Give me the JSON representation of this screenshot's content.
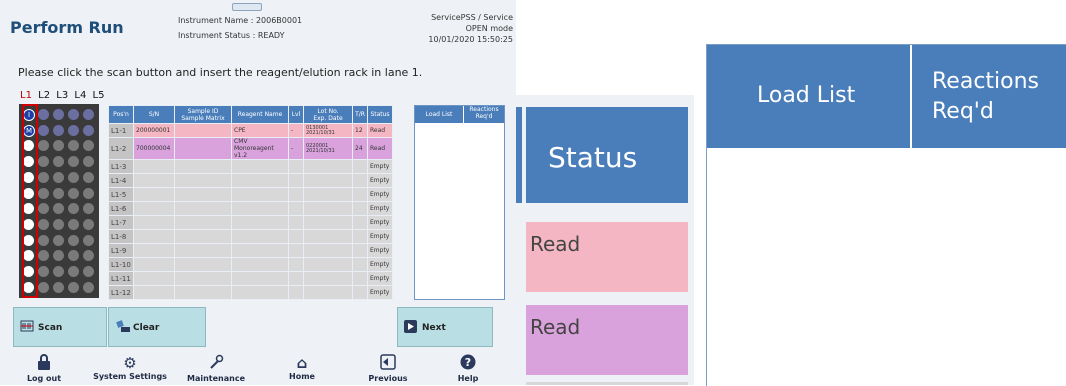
{
  "header": {
    "title": "Perform Run",
    "instrument_name": "Instrument Name : 2006B0001",
    "instrument_status": "Instrument Status : READY",
    "user": "ServicePSS / Service",
    "mode": "OPEN mode",
    "datetime": "10/01/2020 15:50:25"
  },
  "instruction": "Please click the scan button and insert the reagent/elution rack in lane 1.",
  "lanes": [
    "L1",
    "L2",
    "L3",
    "L4",
    "L5"
  ],
  "table": {
    "columns": [
      "Pos'n",
      "S/N",
      "Sample ID\nSample Matrix",
      "Reagent Name",
      "Lvl",
      "Lot No.\nExp. Date",
      "T/R",
      "Status"
    ],
    "rows": [
      {
        "pos": "L1-1",
        "sn": "200000001",
        "sample": "",
        "reagent": "CPE",
        "lvl": "-",
        "lot": "0130001\n2021/10/31",
        "tr": "12",
        "status": "Read"
      },
      {
        "pos": "L1-2",
        "sn": "700000004",
        "sample": "",
        "reagent": "CMV Monoreagent v1.2",
        "lvl": "-",
        "lot": "0220001\n2021/10/31",
        "tr": "24",
        "status": "Read"
      },
      {
        "pos": "L1-3",
        "sn": "",
        "sample": "",
        "reagent": "",
        "lvl": "",
        "lot": "",
        "tr": "",
        "status": "Empty"
      },
      {
        "pos": "L1-4",
        "sn": "",
        "sample": "",
        "reagent": "",
        "lvl": "",
        "lot": "",
        "tr": "",
        "status": "Empty"
      },
      {
        "pos": "L1-5",
        "sn": "",
        "sample": "",
        "reagent": "",
        "lvl": "",
        "lot": "",
        "tr": "",
        "status": "Empty"
      },
      {
        "pos": "L1-6",
        "sn": "",
        "sample": "",
        "reagent": "",
        "lvl": "",
        "lot": "",
        "tr": "",
        "status": "Empty"
      },
      {
        "pos": "L1-7",
        "sn": "",
        "sample": "",
        "reagent": "",
        "lvl": "",
        "lot": "",
        "tr": "",
        "status": "Empty"
      },
      {
        "pos": "L1-8",
        "sn": "",
        "sample": "",
        "reagent": "",
        "lvl": "",
        "lot": "",
        "tr": "",
        "status": "Empty"
      },
      {
        "pos": "L1-9",
        "sn": "",
        "sample": "",
        "reagent": "",
        "lvl": "",
        "lot": "",
        "tr": "",
        "status": "Empty"
      },
      {
        "pos": "L1-10",
        "sn": "",
        "sample": "",
        "reagent": "",
        "lvl": "",
        "lot": "",
        "tr": "",
        "status": "Empty"
      },
      {
        "pos": "L1-11",
        "sn": "",
        "sample": "",
        "reagent": "",
        "lvl": "",
        "lot": "",
        "tr": "",
        "status": "Empty"
      },
      {
        "pos": "L1-12",
        "sn": "",
        "sample": "",
        "reagent": "",
        "lvl": "",
        "lot": "",
        "tr": "",
        "status": "Empty"
      }
    ]
  },
  "load_panel": {
    "load_list": "Load List",
    "reactions": "Reactions\nReq'd"
  },
  "buttons": {
    "scan": "Scan",
    "clear": "Clear",
    "next": "Next"
  },
  "nav": {
    "logout": "Log out",
    "settings": "System Settings",
    "maintenance": "Maintenance",
    "home": "Home",
    "previous": "Previous",
    "help": "Help"
  },
  "zoom_status": {
    "header": "Status",
    "row1": "Read",
    "row2": "Read"
  },
  "zoom_load": {
    "load_list": "Load List",
    "reactions": "Reactions\nReq'd"
  },
  "rack_markers": {
    "slot1": "I",
    "slot2": "M"
  },
  "colors": {
    "header_blue": "#4a7ebb",
    "read_pink": "#f4b6c2",
    "read_purple": "#d9a2dc",
    "button_teal": "#b9dfe4",
    "lane_active": "#c00000"
  },
  "icons": [
    "scan-icon",
    "clear-icon",
    "next-icon",
    "lock-icon",
    "gear-icon",
    "wrench-icon",
    "home-icon",
    "previous-icon",
    "help-icon"
  ]
}
